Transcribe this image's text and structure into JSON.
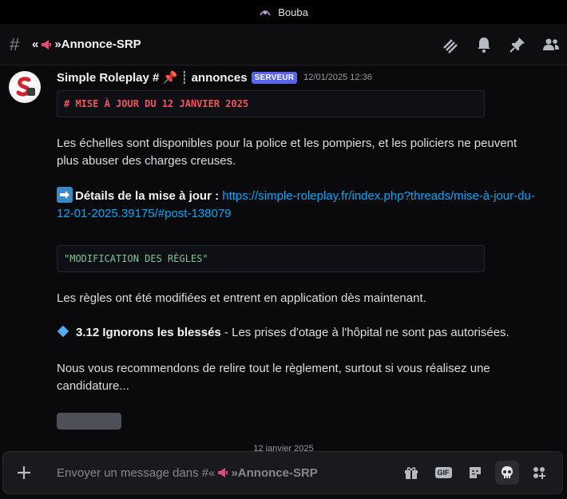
{
  "window": {
    "title": "Bouba"
  },
  "channel": {
    "prefix": "«",
    "suffix": "»Annonce-SRP"
  },
  "message": {
    "author": "Simple Roleplay # 📌 ┊ annonces",
    "badge": "SERVEUR",
    "timestamp": "12/01/2025 12:36",
    "heading_code": "# MISE À JOUR DU 12 JANVIER 2025",
    "paragraph1": "Les échelles sont disponibles pour la police et les pompiers, et les policiers ne peuvent plus abuser des charges creuses.",
    "details_label": "Détails de la mise à jour :",
    "details_link": "https://simple-roleplay.fr/index.php?threads/mise-à-jour-du-12-01-2025.39175/#post-138079",
    "rules_code": "\"MODIFICATION DES RÈGLES\"",
    "paragraph2": "Les règles ont été modifiées et entrent en application dès maintenant.",
    "rule_title": "3.12 Ignorons les blessés",
    "rule_text": " - Les prises d'otage à l'hôpital ne sont pas autorisées.",
    "paragraph3": "Nous vous recommendons de relire tout le règlement, surtout si vous réalisez une candidature..."
  },
  "date_divider": "12 janvier 2025",
  "composer": {
    "placeholder_prefix": "Envoyer un message dans #«",
    "placeholder_suffix": "»Annonce-SRP"
  },
  "icons": {
    "header": [
      "threads-icon",
      "bell-icon",
      "pin-icon",
      "members-icon"
    ],
    "composer": [
      "gift-icon",
      "gif-icon",
      "sticker-icon",
      "skull-icon",
      "apps-icon"
    ]
  }
}
